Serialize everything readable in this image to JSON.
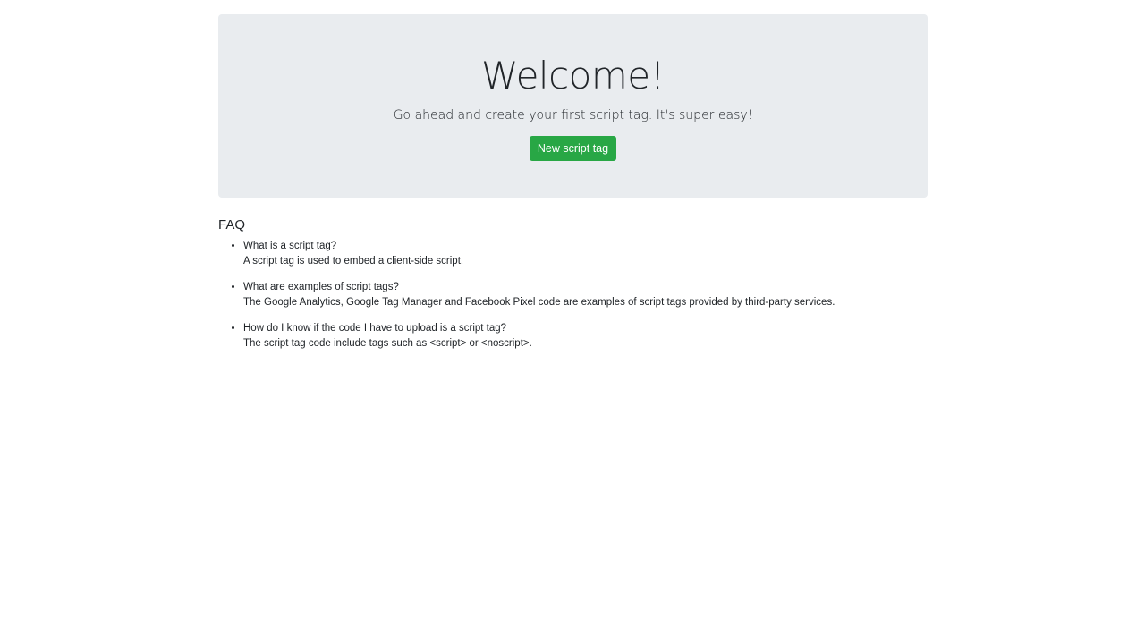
{
  "hero": {
    "title": "Welcome!",
    "subtitle": "Go ahead and create your first script tag. It's super easy!",
    "button_label": "New script tag",
    "button_color": "#28a745",
    "background_color": "#e9ecef"
  },
  "faq": {
    "heading": "FAQ",
    "items": [
      {
        "question": "What is a script tag?",
        "answer": "A script tag is used to embed a client-side script."
      },
      {
        "question": "What are examples of script tags?",
        "answer": "The Google Analytics, Google Tag Manager and Facebook Pixel code are examples of script tags provided by third-party services."
      },
      {
        "question": "How do I know if the code I have to upload is a script tag?",
        "answer": "The script tag code include tags such as <script> or <noscript>."
      }
    ]
  }
}
